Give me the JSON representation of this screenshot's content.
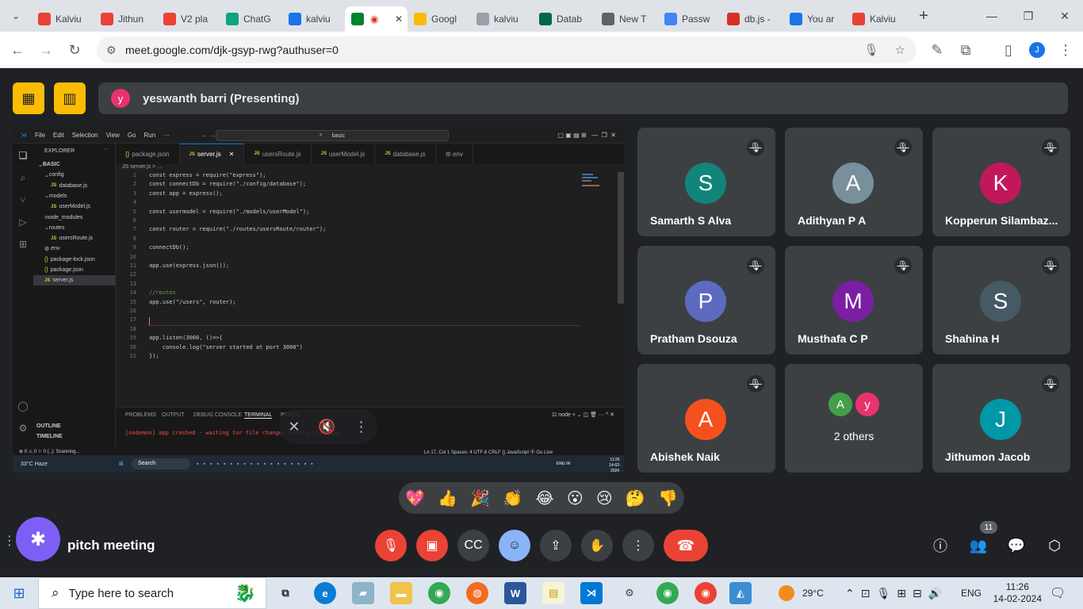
{
  "browser": {
    "tabs": [
      {
        "label": "Kalviu",
        "icon": "kalvium-icon",
        "color": "#e94235"
      },
      {
        "label": "Jithun",
        "icon": "kalvium-icon",
        "color": "#e94235"
      },
      {
        "label": "V2 pla",
        "icon": "gmail-icon",
        "color": "#ea4335"
      },
      {
        "label": "ChatG",
        "icon": "chatgpt-icon",
        "color": "#10a37f"
      },
      {
        "label": "kalviu",
        "icon": "calendar-icon",
        "color": "#1a73e8"
      },
      {
        "label": "",
        "icon": "meet-icon",
        "color": "#00832d",
        "active": true
      },
      {
        "label": "Googl",
        "icon": "google-drive-icon",
        "color": "#fbbc04"
      },
      {
        "label": "kalviu",
        "icon": "kalvium-icon",
        "color": "#9aa0a6"
      },
      {
        "label": "Datab",
        "icon": "mongodb-icon",
        "color": "#00684a"
      },
      {
        "label": "New T",
        "icon": "chrome-icon",
        "color": "#5f6368"
      },
      {
        "label": "Passw",
        "icon": "google-icon",
        "color": "#4285f4"
      },
      {
        "label": "db.js -",
        "icon": "codesandbox-icon",
        "color": "#d93025"
      },
      {
        "label": "You ar",
        "icon": "stackoverflow-icon",
        "color": "#1a73e8"
      },
      {
        "label": "Kalviu",
        "icon": "kalvium-icon",
        "color": "#e94235"
      }
    ],
    "url": "meet.google.com/djk-gsyp-rwg?authuser=0",
    "profile_initial": "J"
  },
  "meet": {
    "presenter_initial": "y",
    "presenter_label": "yeswanth barri (Presenting)",
    "meeting_name": "pitch meeting",
    "participants": [
      {
        "name": "Samarth S Alva",
        "initial": "S",
        "color": "#12857a"
      },
      {
        "name": "Adithyan P A",
        "initial": "A",
        "color": "#78909c"
      },
      {
        "name": "Kopperun Silambaz...",
        "initial": "K",
        "color": "#c2185b"
      },
      {
        "name": "Pratham Dsouza",
        "initial": "P",
        "color": "#5c6bc0"
      },
      {
        "name": "Musthafa C P",
        "initial": "M",
        "color": "#7b1fa2"
      },
      {
        "name": "Shahina H",
        "initial": "S",
        "color": "#455a64"
      },
      {
        "name": "Abishek Naik",
        "initial": "A",
        "color": "#f4511e"
      },
      {
        "name": "Jithumon Jacob",
        "initial": "J",
        "color": "#0097a7"
      }
    ],
    "others": {
      "label": "2 others",
      "initials": [
        "A",
        "y"
      ],
      "colors": [
        "#43a047",
        "#e8336e"
      ]
    },
    "reactions": [
      "💖",
      "👍",
      "🎉",
      "👏",
      "😂",
      "😮",
      "😢",
      "🤔",
      "👎"
    ],
    "people_count": "11"
  },
  "vscode": {
    "menu": [
      "File",
      "Edit",
      "Selection",
      "View",
      "Go",
      "Run",
      "···"
    ],
    "search": "basic",
    "explorer_title": "EXPLORER",
    "tree": [
      {
        "label": "BASIC",
        "indent": 0,
        "kind": "folder"
      },
      {
        "label": "config",
        "indent": 1,
        "kind": "folder"
      },
      {
        "label": "database.js",
        "indent": 2,
        "kind": "js"
      },
      {
        "label": "models",
        "indent": 1,
        "kind": "folder"
      },
      {
        "label": "userModel.js",
        "indent": 2,
        "kind": "js"
      },
      {
        "label": "node_modules",
        "indent": 1,
        "kind": "folder-closed"
      },
      {
        "label": "routes",
        "indent": 1,
        "kind": "folder"
      },
      {
        "label": "usersRoute.js",
        "indent": 2,
        "kind": "js"
      },
      {
        "label": ".env",
        "indent": 1,
        "kind": "env"
      },
      {
        "label": "package-lock.json",
        "indent": 1,
        "kind": "json"
      },
      {
        "label": "package.json",
        "indent": 1,
        "kind": "json"
      },
      {
        "label": "server.js",
        "indent": 1,
        "kind": "js",
        "selected": true
      }
    ],
    "tabs": [
      "package.json",
      "server.js",
      "usersRoute.js",
      "userModel.js",
      "database.js",
      ".env"
    ],
    "breadcrumb": "JS server.js > ...",
    "code_lines": [
      "const express = require(\"express\");",
      "const connectDb = require(\"./config/database\");",
      "const app = express();",
      "",
      "const usermodel = require(\"./models/userModel\");",
      "",
      "const router = require(\"./routes/usersRoute/router\");",
      "",
      "connectDb();",
      "",
      "app.use(express.json());",
      "",
      "",
      "//routes",
      "app.use(\"/users\", router);",
      "",
      "",
      "",
      "app.listen(3000, ()=>{",
      "    console.log(\"server started at port 3000\")",
      "});"
    ],
    "panel_tabs": [
      "PROBLEMS",
      "OUTPUT",
      "DEBUG CONSOLE",
      "TERMINAL",
      "PORTS"
    ],
    "terminal_line": "[nodemon] app crashed - waiting for file changes before starting...",
    "terminal_shell": "node",
    "outline_label": "OUTLINE",
    "timeline_label": "TIMELINE",
    "status_left": "⊗ 0 ⚠ 0   ⚐ 0   {..}: Scanning...",
    "status_right": "Ln 17, Col 1   Spaces: 4   UTF-8   CRLF   {} JavaScript   ⦿ Go Live",
    "inner_taskbar": {
      "weather": "33°C Haze",
      "search": "Search",
      "lang": "ENG IN",
      "time": "11:26",
      "date": "14-02-2024"
    }
  },
  "taskbar": {
    "search_placeholder": "Type here to search",
    "weather": "29°C",
    "lang": "ENG",
    "time": "11:26",
    "date": "14-02-2024"
  }
}
